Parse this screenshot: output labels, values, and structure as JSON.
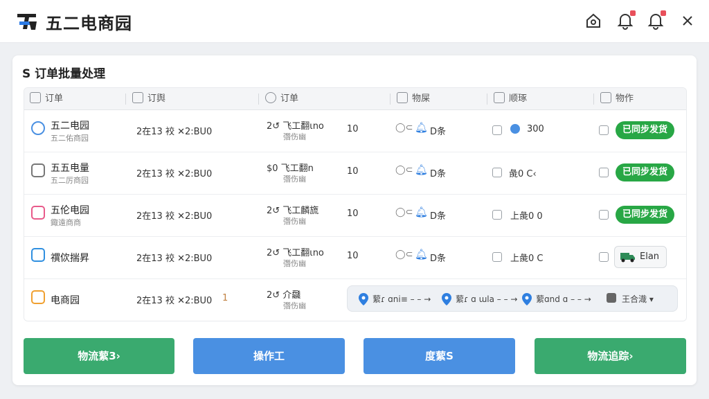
{
  "app": {
    "title": "五二电商园"
  },
  "panel": {
    "title": "S 订单批量处理"
  },
  "columns": [
    "订单",
    "订舆",
    "订单",
    "物屎",
    "顺琢",
    "物作"
  ],
  "rows": [
    {
      "shop": "五二电园",
      "shop_sub": "五二佑商园",
      "time": "2在13 䘨 ✕2:BU0",
      "order": "2↺ 飞工翻ɩno",
      "order_sub": "㣅伤幽",
      "qty": "10",
      "logistics": "D条",
      "amount": "300",
      "status": "已同步发货",
      "icon_color": "#4a90e2"
    },
    {
      "shop": "五五电量",
      "shop_sub": "五二厉商园",
      "time": "2在13 䘨 ✕2:BU0",
      "order": "$0 飞工翻n",
      "order_sub": "㣅伤幽",
      "qty": "10",
      "logistics": "D条",
      "amount": "彘0 C‹",
      "status": "已同步发货",
      "icon_color": "#f0a030"
    },
    {
      "shop": "五伦电园",
      "shop_sub": "鋷遠商商",
      "time": "2在13 䘨 ✕2:BU0",
      "order": "2↺ 飞工麟旒",
      "order_sub": "㣅伤幽",
      "qty": "10",
      "logistics": "D条",
      "amount": "上彘0 0",
      "status": "已同步发货",
      "icon_color": "#e85a8a"
    },
    {
      "shop": "禩佽揣昇",
      "shop_sub": "",
      "time": "2在13 䘨 ✕2:BU0",
      "order": "2↺ 飞工翻ɩno",
      "order_sub": "㣅伤幽",
      "qty": "10",
      "logistics": "D条",
      "amount": "上彘0 C",
      "status": "Elan",
      "icon_color": "#2f8fe0"
    },
    {
      "shop": "电商园",
      "shop_sub": "",
      "time": "2在13 䘨 ✕2:BU0",
      "order": "2↺ 介飝",
      "order_sub": "㣅伤幽",
      "qty": "1",
      "track": [
        "蕠ɾ ɑni≡ – – →",
        "蕠ɾ ɑ ɯla – – →",
        "蕠ɑnd ɑ – – →",
        "王合渽 ▾"
      ]
    }
  ],
  "buttons": [
    "物流蕠3›",
    "操作工",
    "度蕠S",
    "物流追踪›"
  ],
  "colors": {
    "green": "#28a745",
    "blue": "#4a90e2",
    "btn_green": "#3aaa6f"
  }
}
